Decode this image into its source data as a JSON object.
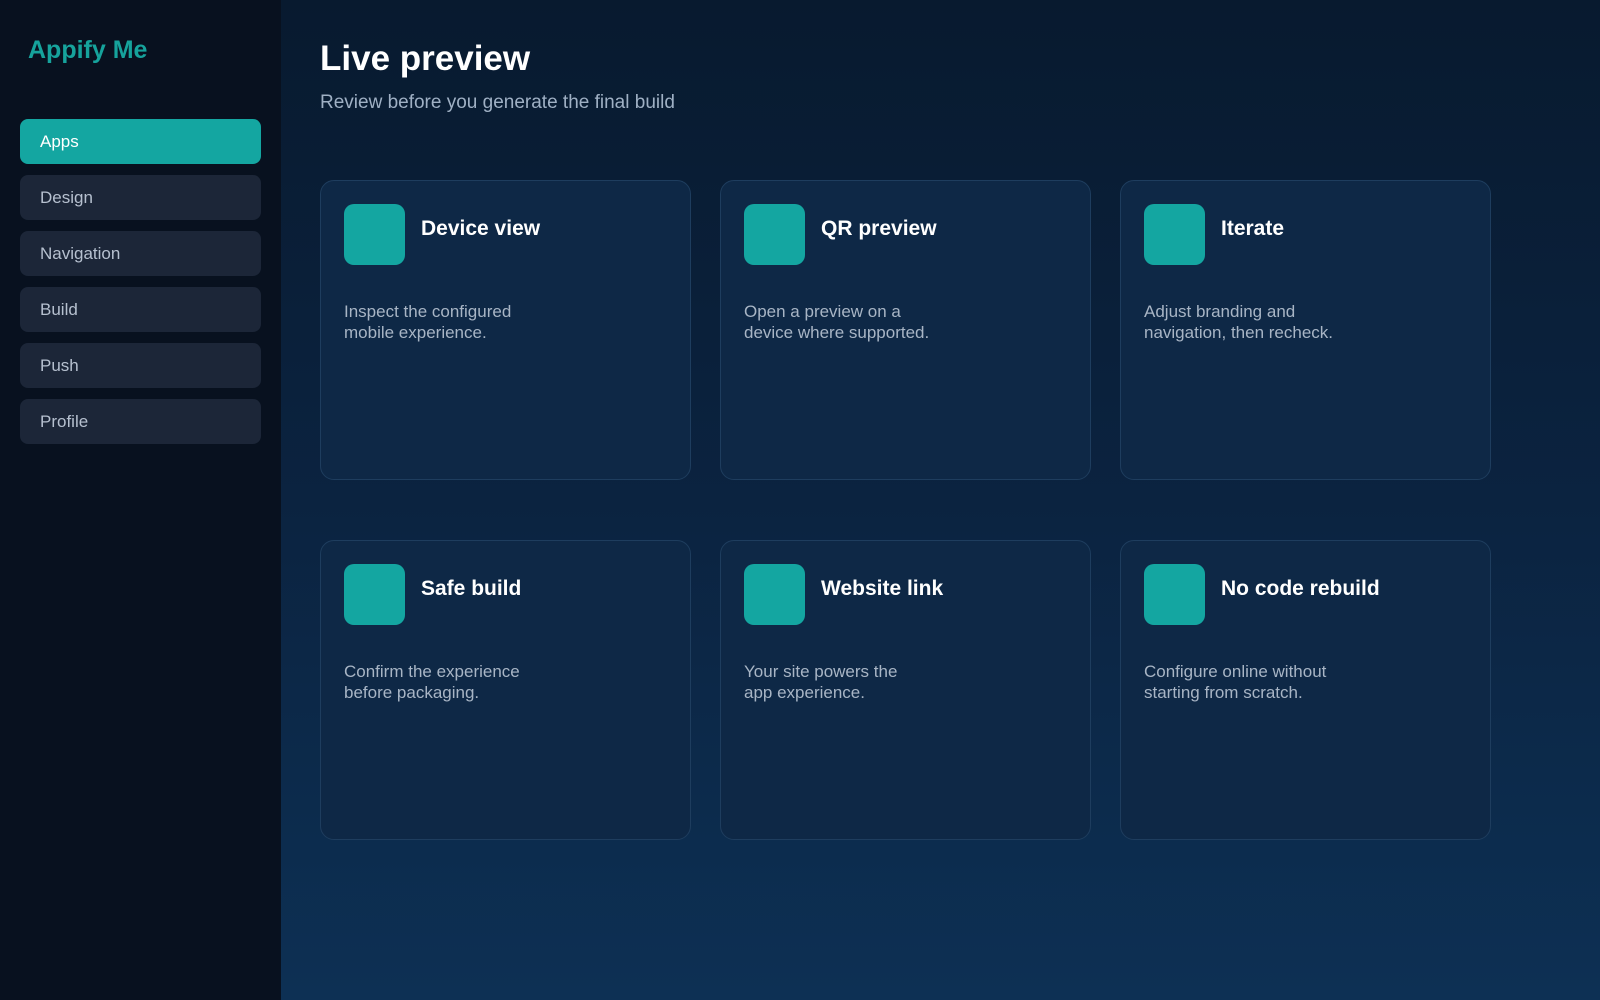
{
  "brand": "Appify Me",
  "sidebar": {
    "items": [
      {
        "label": "Apps",
        "active": true
      },
      {
        "label": "Design"
      },
      {
        "label": "Navigation"
      },
      {
        "label": "Build"
      },
      {
        "label": "Push"
      },
      {
        "label": "Profile"
      }
    ]
  },
  "main": {
    "title": "Live preview",
    "subtitle": "Review before you generate the final build"
  },
  "cards": [
    {
      "title": "Device view",
      "desc_line1": "Inspect the configured",
      "desc_line2": "mobile experience."
    },
    {
      "title": "QR preview",
      "desc_line1": "Open a preview on a",
      "desc_line2": "device where supported."
    },
    {
      "title": "Iterate",
      "desc_line1": "Adjust branding and",
      "desc_line2": "navigation, then recheck."
    },
    {
      "title": "Safe build",
      "desc_line1": "Confirm the experience",
      "desc_line2": "before packaging."
    },
    {
      "title": "Website link",
      "desc_line1": "Your site powers the",
      "desc_line2": "app experience."
    },
    {
      "title": "No code rebuild",
      "desc_line1": "Configure online without",
      "desc_line2": "starting from scratch."
    }
  ],
  "colors": {
    "accent": "#14a6a1",
    "brand": "#16a39c",
    "sidebar_bg": "#08111f",
    "card_bg": "#0e2846"
  }
}
